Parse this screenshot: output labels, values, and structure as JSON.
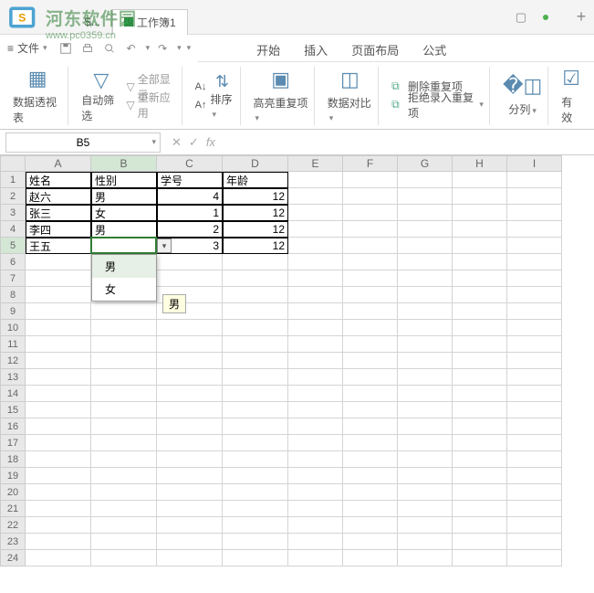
{
  "window": {
    "tab1": "S...",
    "tab2": "工作簿1",
    "add": "+"
  },
  "watermark": {
    "title": "河东软件园",
    "url": "www.pc0359.cn"
  },
  "qat": {
    "file": "文件"
  },
  "menu": {
    "start": "开始",
    "insert": "插入",
    "layout": "页面布局",
    "formula": "公式"
  },
  "ribbon": {
    "pivot": "数据透视表",
    "filter": "自动筛选",
    "showAll": "全部显示",
    "reapply": "重新应用",
    "sort": "排序",
    "highlight": "高亮重复项",
    "compare": "数据对比",
    "delDup": "删除重复项",
    "rejectDup": "拒绝录入重复项",
    "split": "分列",
    "valid": "有效"
  },
  "namebox": {
    "ref": "B5"
  },
  "headers": [
    "A",
    "B",
    "C",
    "D",
    "E",
    "F",
    "G",
    "H",
    "I"
  ],
  "rows": [
    "1",
    "2",
    "3",
    "4",
    "5",
    "6",
    "7",
    "8",
    "9",
    "10",
    "11",
    "12",
    "13",
    "14",
    "15",
    "16",
    "17",
    "18",
    "19",
    "20",
    "21",
    "22",
    "23",
    "24"
  ],
  "table": {
    "h": {
      "name": "姓名",
      "gender": "性别",
      "id": "学号",
      "age": "年龄"
    },
    "r1": {
      "name": "赵六",
      "gender": "男",
      "id": "4",
      "age": "12"
    },
    "r2": {
      "name": "张三",
      "gender": "女",
      "id": "1",
      "age": "12"
    },
    "r3": {
      "name": "李四",
      "gender": "男",
      "id": "2",
      "age": "12"
    },
    "r4": {
      "name": "王五",
      "gender": "",
      "id": "3",
      "age": "12"
    }
  },
  "dropdown": {
    "opt1": "男",
    "opt2": "女"
  },
  "tooltip": {
    "text": "男"
  }
}
